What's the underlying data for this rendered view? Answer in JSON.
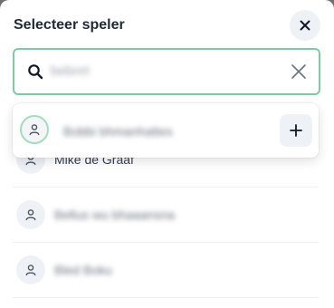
{
  "dialog": {
    "title": "Selecteer speler"
  },
  "search": {
    "value": "bebnrt"
  },
  "suggestion": {
    "name": "Bobbi bhmanhattes"
  },
  "players": [
    {
      "name": "Mike de Graaf",
      "blurred": false
    },
    {
      "name": "Bellus wu bhaaansna",
      "blurred": true
    },
    {
      "name": "Bled Boku",
      "blurred": true
    }
  ],
  "icons": {
    "close": "close-icon",
    "search": "search-icon",
    "clear": "clear-icon",
    "user": "user-icon",
    "add": "plus-icon"
  },
  "colors": {
    "accent": "#7fc9a3",
    "soft_bg": "#eef2f7"
  }
}
